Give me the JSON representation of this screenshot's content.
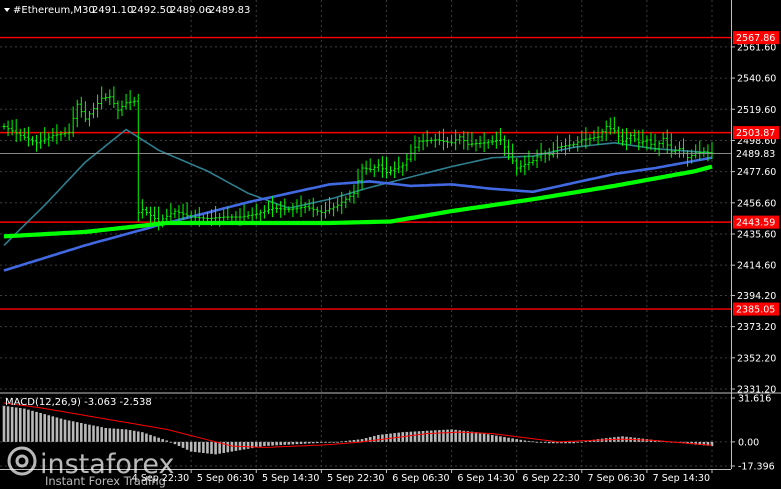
{
  "header": {
    "symbol_label": "#Ethereum,M30",
    "ohlc": [
      "2491.10",
      "2492.50",
      "2489.06",
      "2489.83"
    ]
  },
  "macd_label": "MACD(12,26,9) -3.063 -2.538",
  "logo": {
    "name": "instaforex",
    "tagline": "Instant Forex Trading"
  },
  "colors": {
    "background": "#000000",
    "grid": "#3c3c3c",
    "axis": "#c0c0c0",
    "price": "#00ff00",
    "level_line": "#ff0000",
    "level_tag_bg": "#ff0000",
    "ma_fast": "#2f7f8f",
    "ma_mid": "#4169e1",
    "ma_slow": "#00ff00",
    "macd_hist": "#b8b8b8",
    "macd_signal": "#ff0000"
  },
  "chart_data": [
    {
      "type": "line",
      "title": "#Ethereum,M30",
      "ylim": [
        2331.2,
        2575
      ],
      "y_ticks": [
        "2561.60",
        "2540.60",
        "2519.60",
        "2498.60",
        "2477.60",
        "2456.60",
        "2435.60",
        "2414.60",
        "2394.20",
        "2373.20",
        "2352.20",
        "2331.20"
      ],
      "x_tick_labels": [
        "4 Sep 22:30",
        "5 Sep 06:30",
        "5 Sep 14:30",
        "5 Sep 22:30",
        "6 Sep 06:30",
        "6 Sep 14:30",
        "6 Sep 22:30",
        "7 Sep 06:30",
        "7 Sep 14:30"
      ],
      "x_tick_index": [
        46,
        62,
        78,
        94,
        110,
        126,
        142,
        158,
        174
      ],
      "n_bars": 175,
      "current_price": {
        "value": 2489.83,
        "label": "2489.83"
      },
      "levels": [
        {
          "value": 2567.86,
          "label": "2567.86"
        },
        {
          "value": 2503.87,
          "label": "2503.87"
        },
        {
          "value": 2443.59,
          "label": "2443.59"
        },
        {
          "value": 2385.05,
          "label": "2385.05"
        }
      ],
      "series": [
        {
          "kind": "price",
          "x": [
            0,
            4,
            8,
            12,
            16,
            18,
            20,
            24,
            26,
            28,
            30,
            32,
            33,
            34,
            36,
            38,
            42,
            46,
            50,
            54,
            58,
            62,
            66,
            70,
            74,
            78,
            82,
            86,
            88,
            90,
            92,
            94,
            98,
            102,
            106,
            110,
            112,
            114,
            118,
            122,
            126,
            130,
            132,
            134,
            136,
            140,
            142,
            146,
            148,
            150,
            152,
            154,
            156,
            158,
            160,
            162,
            164,
            166,
            168,
            170,
            172,
            174
          ],
          "values": [
            2508,
            2502,
            2497,
            2502,
            2504,
            2523,
            2513,
            2527,
            2528,
            2519,
            2524,
            2525,
            2450,
            2452,
            2448,
            2444,
            2451,
            2447,
            2446,
            2447,
            2447,
            2449,
            2453,
            2452,
            2454,
            2450,
            2455,
            2463,
            2480,
            2479,
            2482,
            2477,
            2482,
            2498,
            2499,
            2497,
            2501,
            2496,
            2497,
            2499,
            2480,
            2485,
            2490,
            2489,
            2494,
            2496,
            2499,
            2501,
            2508,
            2505,
            2498,
            2502,
            2497,
            2499,
            2493,
            2500,
            2491,
            2493,
            2487,
            2490,
            2491,
            2490
          ]
        },
        {
          "kind": "ma_fast",
          "x": [
            0,
            10,
            20,
            30,
            38,
            50,
            60,
            70,
            80,
            90,
            100,
            110,
            120,
            130,
            140,
            150,
            160,
            170,
            174
          ],
          "values": [
            2428,
            2455,
            2484,
            2506,
            2492,
            2478,
            2463,
            2453,
            2459,
            2467,
            2474,
            2481,
            2487,
            2488,
            2494,
            2497,
            2493,
            2491,
            2490
          ]
        },
        {
          "kind": "ma_mid",
          "x": [
            0,
            20,
            40,
            60,
            80,
            90,
            100,
            110,
            120,
            130,
            140,
            150,
            160,
            170,
            174
          ],
          "values": [
            2411,
            2428,
            2443,
            2457,
            2469,
            2471,
            2468,
            2469,
            2466,
            2464,
            2470,
            2476,
            2480,
            2485,
            2487
          ]
        },
        {
          "kind": "ma_slow",
          "x": [
            0,
            20,
            40,
            60,
            80,
            95,
            110,
            130,
            150,
            170,
            174
          ],
          "values": [
            2434,
            2437,
            2443,
            2443,
            2443,
            2444,
            2451,
            2459,
            2468,
            2478,
            2481
          ]
        }
      ]
    },
    {
      "type": "bar",
      "title": "MACD(12,26,9) -3.063 -2.538",
      "ylim": [
        -17.396,
        31.616
      ],
      "y_ticks": [
        "31.616",
        "0.00",
        "-17.396"
      ],
      "series": [
        {
          "kind": "histogram",
          "x": [
            0,
            5,
            10,
            15,
            20,
            25,
            30,
            34,
            40,
            46,
            52,
            58,
            64,
            70,
            76,
            82,
            88,
            92,
            98,
            104,
            110,
            116,
            122,
            128,
            134,
            140,
            146,
            152,
            158,
            164,
            170,
            174
          ],
          "values": [
            26,
            24,
            20,
            16,
            13,
            10,
            9,
            7,
            1,
            -7,
            -9,
            -6,
            -3,
            -2,
            -1,
            0,
            2,
            5,
            7,
            8,
            9,
            7,
            4,
            1,
            -1,
            -1,
            2,
            4,
            2,
            0,
            -2,
            -3
          ]
        },
        {
          "kind": "signal",
          "x": [
            0,
            8,
            16,
            24,
            32,
            40,
            48,
            56,
            64,
            72,
            80,
            88,
            96,
            104,
            112,
            120,
            128,
            136,
            144,
            152,
            160,
            168,
            174
          ],
          "values": [
            28,
            25,
            21,
            17,
            13,
            9,
            3,
            -3,
            -4,
            -3,
            -2,
            0,
            3,
            6,
            7,
            6,
            3,
            0,
            1,
            2,
            1,
            -1,
            -2.5
          ]
        }
      ]
    }
  ]
}
